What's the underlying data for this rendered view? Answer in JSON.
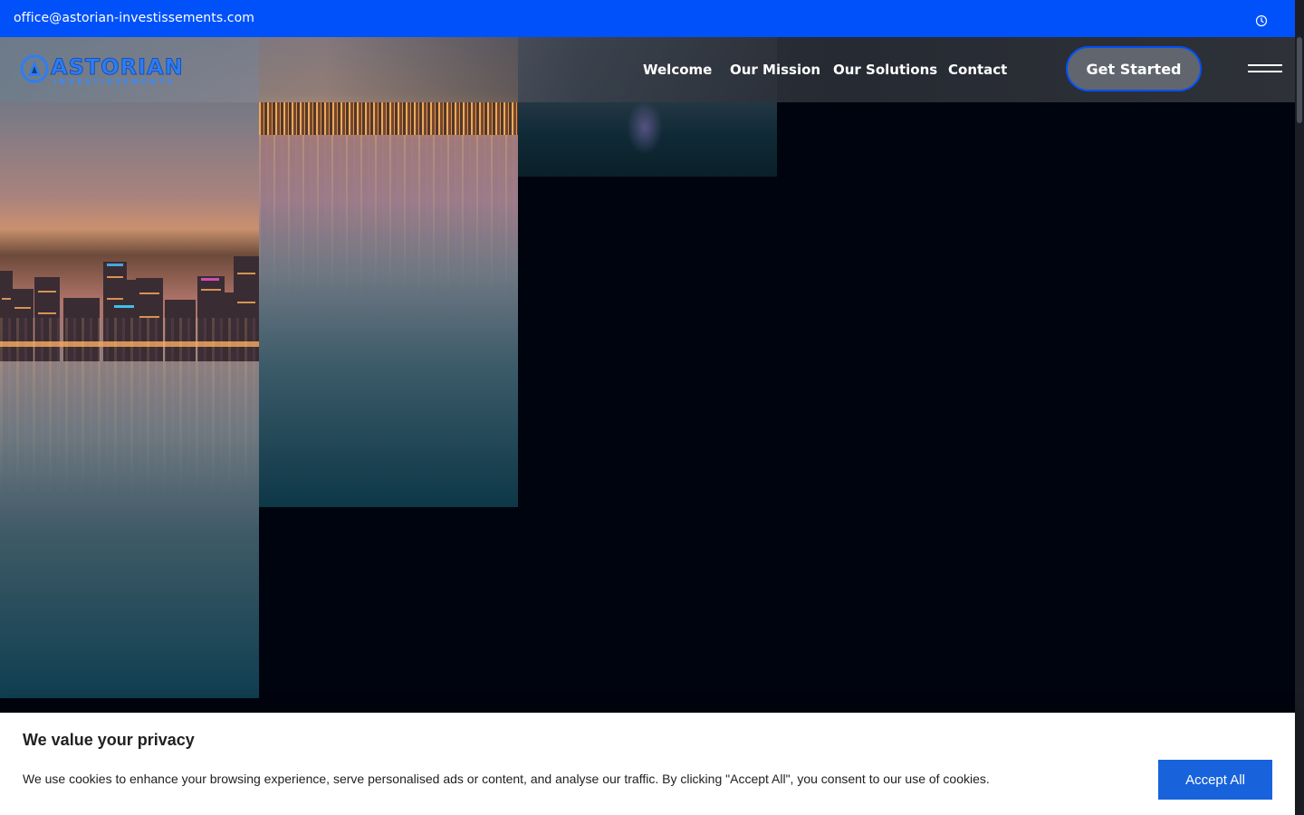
{
  "topbar": {
    "email": "office@astorian-investissements.com",
    "clock_icon": "clock-icon"
  },
  "brand": {
    "name": "ASTORIAN",
    "tagline": "INVESTISSEMENTS",
    "color": "#2e7df3"
  },
  "nav": {
    "items": [
      {
        "label": "Welcome"
      },
      {
        "label": "Our Mission"
      },
      {
        "label": "Our Solutions"
      },
      {
        "label": "Contact"
      }
    ],
    "cta_label": "Get Started",
    "menu_icon": "hamburger-icon"
  },
  "cookie_banner": {
    "title": "We value your privacy",
    "text": "We use cookies to enhance your browsing experience, serve personalised ads or content, and analyse our traffic. By clicking \"Accept All\", you consent to our use of cookies.",
    "accept_label": "Accept All"
  },
  "colors": {
    "accent": "#0151fb",
    "accept_button": "#1863dc",
    "background": "#00040e"
  }
}
